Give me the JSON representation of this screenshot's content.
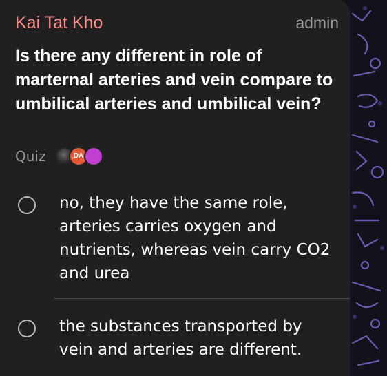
{
  "message": {
    "sender": "Kai Tat Kho",
    "role": "admin",
    "question": "Is there any different in role of marternal arteries and vein compare to umbilical arteries and umbilical vein?",
    "quiz_label": "Quiz",
    "voter_avatars": [
      {
        "kind": "photo"
      },
      {
        "initials": "DA",
        "color": "#e25a3c"
      },
      {
        "kind": "illustration",
        "color": "#c03fd0"
      }
    ],
    "options": [
      {
        "text": "no, they have the same role, arteries carries oxygen and nutrients, whereas vein carry CO2 and urea"
      },
      {
        "text": "the substances transported by vein and arteries are different."
      }
    ]
  },
  "colors": {
    "sender_name": "#ff8a8a",
    "bubble_bg": "#202020",
    "chat_bg": "#14101c"
  }
}
